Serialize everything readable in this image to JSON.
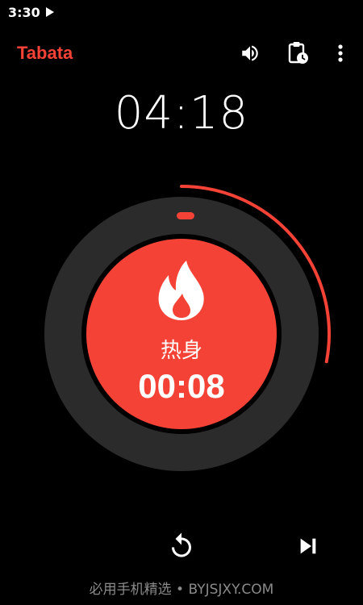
{
  "status_bar": {
    "time": "3:30",
    "icons": [
      "play-icon"
    ]
  },
  "app_bar": {
    "title": "Tabata",
    "actions": [
      "volume-icon",
      "clipboard-clock-icon",
      "more-vert-icon"
    ]
  },
  "total_time": "04:18",
  "timer": {
    "phase_label": "热身",
    "phase_time": "00:08",
    "phase_icon": "fire-icon",
    "progress_fraction": 0.28
  },
  "controls": {
    "reset_icon": "reset-icon",
    "skip_icon": "skip-next-icon"
  },
  "watermark": "必用手机精选 • BYJSJXY.COM",
  "colors": {
    "accent": "#F44336",
    "background": "#000000",
    "ring": "#2B2B2B",
    "text": "#FFFFFF",
    "watermark": "#8A8A8A"
  }
}
